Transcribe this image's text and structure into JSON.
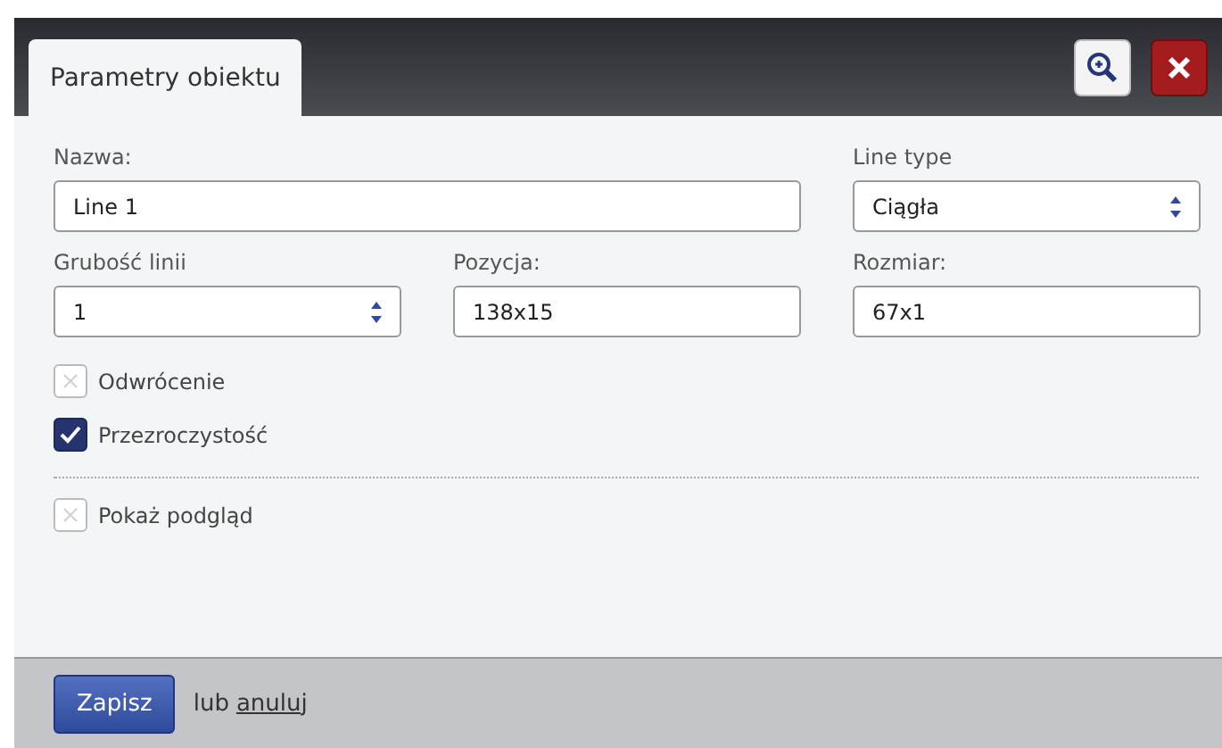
{
  "tabs": [
    {
      "label": "Parametry obiektu",
      "selected": true
    }
  ],
  "fields": [
    {
      "label": "Nazwa:",
      "value": "Line 1",
      "kind": "text"
    },
    {
      "label": "Line type",
      "value": "Ciągła",
      "kind": "select"
    },
    {
      "label": "Grubość linii",
      "value": "1",
      "kind": "spinner"
    },
    {
      "label": "Pozycja:",
      "value": "138x15",
      "kind": "text"
    },
    {
      "label": "Rozmiar:",
      "value": "67x1",
      "kind": "text"
    }
  ],
  "options": [
    {
      "label": "Odwrócenie",
      "checked": false
    },
    {
      "label": "Przezroczystość",
      "checked": true
    }
  ],
  "preview_option": {
    "label": "Pokaż podgląd",
    "checked": false
  },
  "footer": {
    "save": "Zapisz",
    "or": "lub",
    "cancel": "anuluj"
  }
}
